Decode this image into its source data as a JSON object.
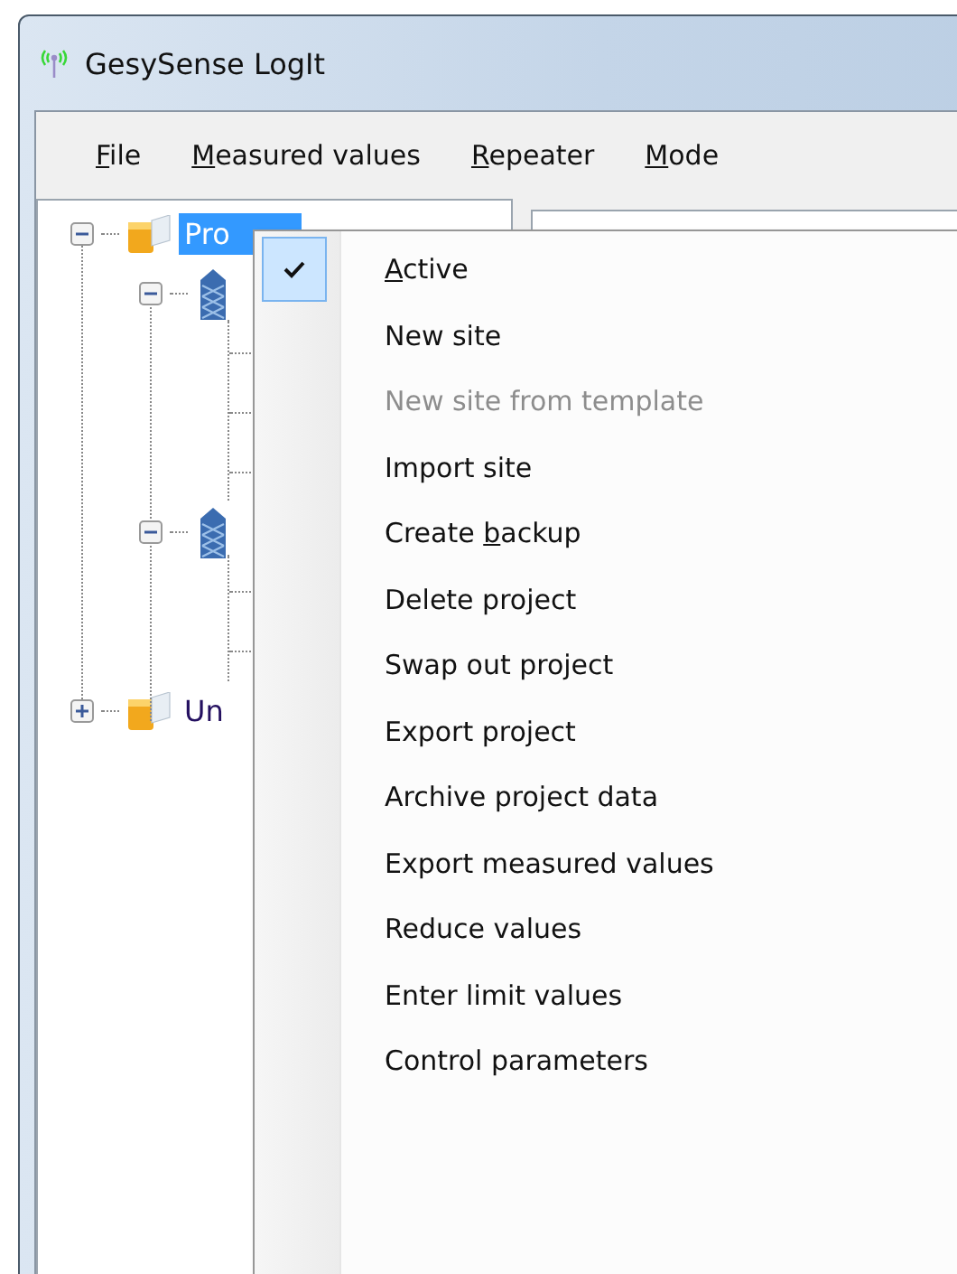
{
  "window": {
    "title": "GesySense LogIt"
  },
  "menu_bar": [
    {
      "key": "F",
      "after": "ile"
    },
    {
      "key": "M",
      "after": "easured values"
    },
    {
      "key": "R",
      "after": "epeater"
    },
    {
      "key": "M",
      "after": "ode"
    }
  ],
  "tree": [
    {
      "label": "Pro",
      "kind": "project",
      "expanded": true,
      "selected": true,
      "children": [
        {
          "kind": "site",
          "expanded": true,
          "children": [
            {
              "kind": "leaf"
            },
            {
              "kind": "leaf"
            },
            {
              "kind": "leaf"
            }
          ]
        },
        {
          "kind": "site",
          "expanded": true,
          "children": [
            {
              "kind": "leaf"
            },
            {
              "kind": "leaf"
            }
          ]
        }
      ]
    },
    {
      "label": "Un",
      "kind": "project",
      "expanded": false,
      "selected": false
    }
  ],
  "context_menu": [
    {
      "key": "A",
      "after": "ctive",
      "checked": true,
      "disabled": false
    },
    {
      "before": "New site",
      "checked": false,
      "disabled": false
    },
    {
      "before": "New site from template",
      "checked": false,
      "disabled": true
    },
    {
      "before": "Import site",
      "checked": false,
      "disabled": false
    },
    {
      "before": "Create ",
      "key": "b",
      "after": "ackup",
      "checked": false,
      "disabled": false
    },
    {
      "before": "Delete project",
      "checked": false,
      "disabled": false
    },
    {
      "before": "Swap out project",
      "checked": false,
      "disabled": false
    },
    {
      "before": "Export project",
      "checked": false,
      "disabled": false
    },
    {
      "before": "Archive project data",
      "checked": false,
      "disabled": false
    },
    {
      "before": "Export measured values",
      "checked": false,
      "disabled": false
    },
    {
      "before": "Reduce values",
      "checked": false,
      "disabled": false
    },
    {
      "before": "Enter limit values",
      "checked": false,
      "disabled": false
    },
    {
      "before": "Control parameters",
      "checked": false,
      "disabled": false
    }
  ]
}
